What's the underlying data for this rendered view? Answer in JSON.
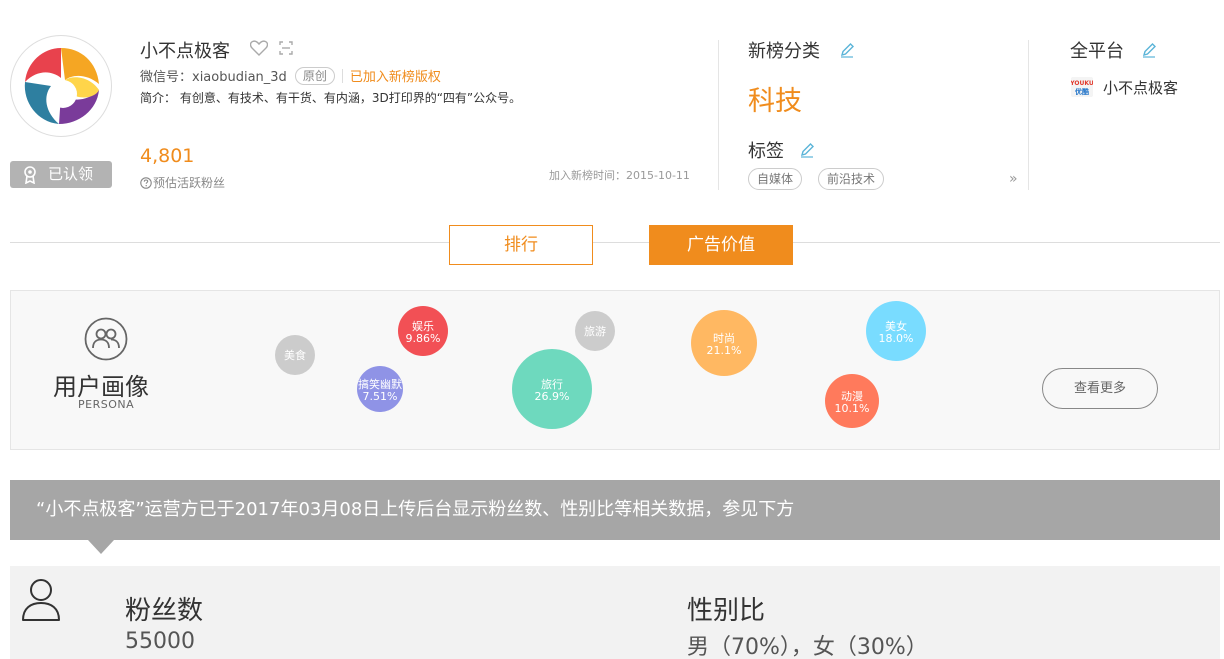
{
  "profile": {
    "name": "小不点极客",
    "wechat_id": "微信号：xiaobudian_3d",
    "original_tag": "原创",
    "copyright": "已加入新榜版权",
    "intro": "简介：  有创意、有技术、有干货、有内涵，3D打印界的“四有”公众号。",
    "claimed_label": "已认领",
    "fans_count": "4,801",
    "fans_label": "预估活跃粉丝",
    "join_time": "加入新榜时间：2015-10-11"
  },
  "category": {
    "title": "新榜分类",
    "value": "科技",
    "tags_title": "标签",
    "tags": [
      "自媒体",
      "前沿技术"
    ],
    "more_arrow": "»"
  },
  "platform": {
    "title": "全平台",
    "youku_label": "优酷",
    "name": "小不点极客"
  },
  "tabs": [
    {
      "label": "排行",
      "active": false
    },
    {
      "label": "广告价值",
      "active": true
    }
  ],
  "persona": {
    "title": "用户画像",
    "subtitle": "PERSONA",
    "see_more": "查看更多",
    "bubbles": [
      {
        "label": "美食",
        "value": "",
        "color": "#cccccc"
      },
      {
        "label": "娱乐",
        "value": "9.86%",
        "color": "#f25055"
      },
      {
        "label": "搞笑幽默",
        "value": "7.51%",
        "color": "#8f93e6"
      },
      {
        "label": "旅游",
        "value": "",
        "color": "#cccccc"
      },
      {
        "label": "旅行",
        "value": "26.9%",
        "color": "#6ed9be"
      },
      {
        "label": "时尚",
        "value": "21.1%",
        "color": "#ffb862"
      },
      {
        "label": "动漫",
        "value": "10.1%",
        "color": "#ff7a5c"
      },
      {
        "label": "美女",
        "value": "18.0%",
        "color": "#79dcff"
      }
    ]
  },
  "notice": "“小不点极客”运营方已于2017年03月08日上传后台显示粉丝数、性别比等相关数据，参见下方",
  "stats": {
    "fans_label": "粉丝数",
    "fans_value": "55000",
    "gender_label": "性别比",
    "gender_value": "男（70%），女（30%）"
  },
  "colors": {
    "accent": "#f08c1d",
    "banner": "#a6a6a6"
  }
}
